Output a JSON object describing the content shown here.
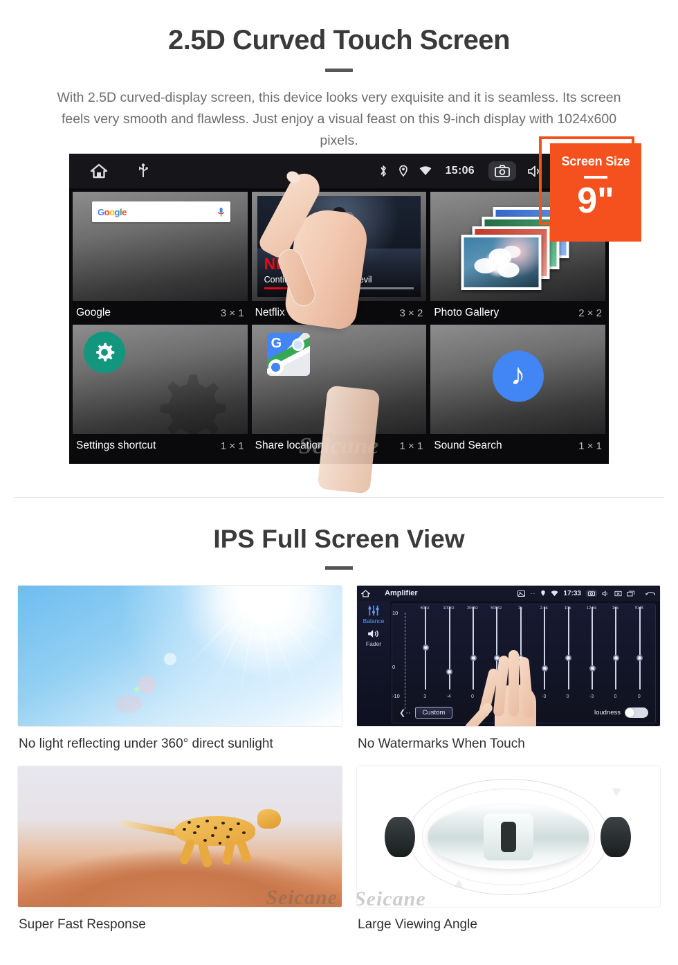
{
  "section1": {
    "title": "2.5D Curved Touch Screen",
    "paragraph": "With 2.5D curved-display screen, this device looks very exquisite and it is seamless. Its screen feels very smooth and flawless. Just enjoy a visual feast on this 9-inch display with 1024x600 pixels."
  },
  "badge": {
    "label": "Screen Size",
    "value": "9\"",
    "color": "#f4511e"
  },
  "device": {
    "statusbar": {
      "left_icons": [
        "home-icon",
        "usb-icon"
      ],
      "right_icons": [
        "bluetooth-icon",
        "location-icon",
        "wifi-icon"
      ],
      "clock": "15:06",
      "tray_icons": [
        "camera-icon",
        "volume-icon",
        "close-box-icon",
        "recents-icon"
      ]
    },
    "widgets": [
      {
        "name": "Google",
        "dims": "3 × 1",
        "icon": "google-search-widget",
        "search_placeholder": "Google"
      },
      {
        "name": "Netflix",
        "dims": "3 × 2",
        "icon": "netflix-widget",
        "brand": "NETFLIX",
        "subtitle": "Continue Marvel's Daredevil"
      },
      {
        "name": "Photo Gallery",
        "dims": "2 × 2",
        "icon": "photo-gallery-widget"
      },
      {
        "name": "Settings shortcut",
        "dims": "1 × 1",
        "icon": "gear-icon"
      },
      {
        "name": "Share location",
        "dims": "1 × 1",
        "icon": "google-maps-icon"
      },
      {
        "name": "Sound Search",
        "dims": "1 × 1",
        "icon": "music-note-icon"
      }
    ],
    "watermark": "Seicane"
  },
  "section2": {
    "title": "IPS Full Screen View",
    "cards": [
      {
        "caption": "No light reflecting under 360° direct sunlight",
        "image": "sunny-blue-sky"
      },
      {
        "caption": "No Watermarks When Touch",
        "image": "amplifier-equalizer-screen"
      },
      {
        "caption": "Super Fast Response",
        "image": "running-cheetah"
      },
      {
        "caption": "Large Viewing Angle",
        "image": "car-top-view"
      }
    ]
  },
  "amplifier": {
    "title": "Amplifier",
    "clock": "17:33",
    "sidebar": [
      "Balance",
      "Fader"
    ],
    "preset_button": "Custom",
    "loudness_label": "loudness",
    "loudness_on": false,
    "axis_labels": [
      "10",
      "0",
      "-10"
    ],
    "bands": [
      {
        "freq": "60hz",
        "value": "3"
      },
      {
        "freq": "100hz",
        "value": "-4"
      },
      {
        "freq": "200hz",
        "value": "0"
      },
      {
        "freq": "500hz",
        "value": "0"
      },
      {
        "freq": "1k",
        "value": "0"
      },
      {
        "freq": "2.5k",
        "value": "-3"
      },
      {
        "freq": "10k",
        "value": "0"
      },
      {
        "freq": "12.5k",
        "value": "-3"
      },
      {
        "freq": "15k",
        "value": "0"
      },
      {
        "freq": "SUB",
        "value": "0"
      }
    ]
  },
  "watermarks": {
    "brand": "Seicane"
  }
}
